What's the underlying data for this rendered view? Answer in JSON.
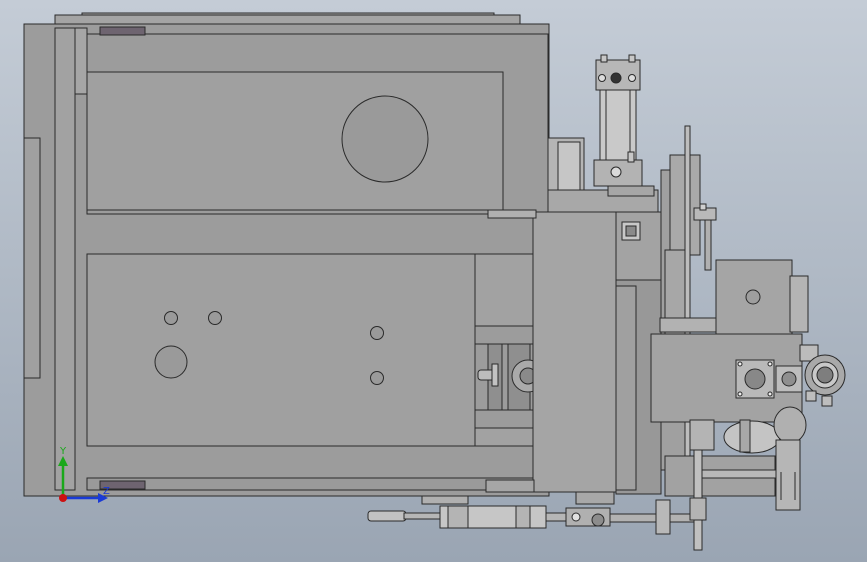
{
  "viewport": {
    "background_top": "#c4ccd6",
    "background_bottom": "#9aa5b3"
  },
  "colors": {
    "body": "#9c9c9c",
    "body_light": "#b3b3b3",
    "body_dark": "#7d7d7d",
    "edge": "#2a2a2a",
    "pad": "#6e6470",
    "axis_x": "#cc1111",
    "axis_y": "#1aa81a",
    "axis_z": "#1a3ad6"
  },
  "triad": {
    "y_label": "Y",
    "z_label": "Z"
  }
}
